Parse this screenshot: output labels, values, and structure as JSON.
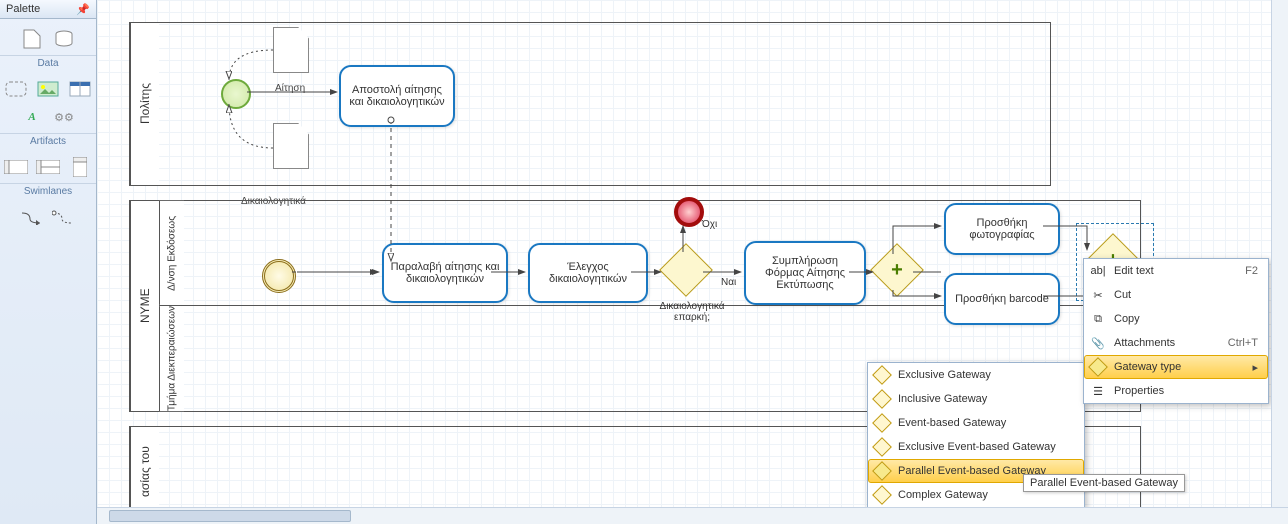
{
  "palette": {
    "title": "Palette",
    "sections": {
      "data": "Data",
      "artifacts": "Artifacts",
      "swimlanes": "Swimlanes"
    }
  },
  "pools": {
    "p1": {
      "title": "Πολίτης"
    },
    "p2": {
      "title": "NYME",
      "lanes": {
        "l1": "Δ/νση Εκδόσεως",
        "l2": "Τμήμα Διεκπεραιώσεων"
      }
    },
    "p3": {
      "title": "ασίας του"
    }
  },
  "data_objects": {
    "d1": "Αίτηση",
    "d2": "Δικαιολογητικά"
  },
  "tasks": {
    "t1": "Αποστολή αίτησης και δικαιολογητικών",
    "t2": "Παραλαβή αίτησης και δικαιολογητικών",
    "t3": "Έλεγχος δικαιολογητικών",
    "t4": "Συμπλήρωση Φόρμας Αίτησης Εκτύπωσης",
    "t5": "Προσθήκη φωτογραφίας",
    "t6": "Προσθήκη barcode"
  },
  "gateways": {
    "g1_label": "Δικαιολογητικά επαρκή;"
  },
  "branches": {
    "no": "Όχι",
    "yes": "Ναι"
  },
  "context_menu": {
    "edit_text": {
      "label": "Edit text",
      "shortcut": "F2"
    },
    "cut": "Cut",
    "copy": "Copy",
    "attachments": {
      "label": "Attachments",
      "shortcut": "Ctrl+T"
    },
    "gateway_type": "Gateway type",
    "properties": "Properties"
  },
  "gateway_submenu": {
    "exclusive": "Exclusive Gateway",
    "inclusive": "Inclusive Gateway",
    "event": "Event-based Gateway",
    "excl_event": "Exclusive Event-based Gateway",
    "par_event": "Parallel Event-based Gateway",
    "complex": "Complex Gateway"
  },
  "tooltip": "Parallel Event-based Gateway",
  "chart_data": {
    "type": "table",
    "description": "BPMN process model with pools/lanes, tasks, gateways and flows",
    "pools": [
      {
        "id": "p1",
        "name": "Πολίτης",
        "lanes": [
          {
            "id": "p1l1",
            "name": ""
          }
        ]
      },
      {
        "id": "p2",
        "name": "NYME",
        "lanes": [
          {
            "id": "p2l1",
            "name": "Δ/νση Εκδόσεως"
          },
          {
            "id": "p2l2",
            "name": "Τμήμα Διεκπεραιώσεων"
          }
        ]
      },
      {
        "id": "p3",
        "name": "ασίας του",
        "lanes": [
          {
            "id": "p3l1",
            "name": ""
          }
        ]
      }
    ],
    "elements": [
      {
        "id": "se1",
        "type": "startEvent",
        "pool": "p1",
        "lane": "p1l1"
      },
      {
        "id": "d1",
        "type": "dataObject",
        "name": "Αίτηση",
        "pool": "p1"
      },
      {
        "id": "d2",
        "type": "dataObject",
        "name": "Δικαιολογητικά",
        "pool": "p1"
      },
      {
        "id": "t1",
        "type": "task",
        "name": "Αποστολή αίτησης και δικαιολογητικών",
        "pool": "p1"
      },
      {
        "id": "se2",
        "type": "startEvent",
        "subtype": "non-interrupting-message",
        "pool": "p2",
        "lane": "p2l1"
      },
      {
        "id": "t2",
        "type": "task",
        "name": "Παραλαβή αίτησης και δικαιολογητικών",
        "pool": "p2",
        "lane": "p2l1"
      },
      {
        "id": "t3",
        "type": "task",
        "name": "Έλεγχος δικαιολογητικών",
        "pool": "p2",
        "lane": "p2l1"
      },
      {
        "id": "g1",
        "type": "exclusiveGateway",
        "name": "Δικαιολογητικά επαρκή;",
        "pool": "p2",
        "lane": "p2l1"
      },
      {
        "id": "ee1",
        "type": "endEvent",
        "pool": "p2",
        "lane": "p2l1"
      },
      {
        "id": "t4",
        "type": "task",
        "name": "Συμπλήρωση Φόρμας Αίτησης Εκτύπωσης",
        "pool": "p2",
        "lane": "p2l1"
      },
      {
        "id": "g2",
        "type": "parallelGateway",
        "pool": "p2",
        "lane": "p2l1"
      },
      {
        "id": "t5",
        "type": "task",
        "name": "Προσθήκη φωτογραφίας",
        "pool": "p2",
        "lane": "p2l1"
      },
      {
        "id": "t6",
        "type": "task",
        "name": "Προσθήκη barcode",
        "pool": "p2",
        "lane": "p2l1"
      },
      {
        "id": "g3",
        "type": "parallelGateway",
        "pool": "p2",
        "lane": "p2l1",
        "selected": true
      },
      {
        "id": "ie1",
        "type": "intermediateEvent",
        "pool": "p2",
        "lane": "p2l1"
      }
    ],
    "sequence_flows": [
      {
        "from": "se1",
        "to": "t1"
      },
      {
        "from": "se2",
        "to": "t2"
      },
      {
        "from": "t2",
        "to": "t3"
      },
      {
        "from": "t3",
        "to": "g1"
      },
      {
        "from": "g1",
        "to": "ee1",
        "condition": "Όχι"
      },
      {
        "from": "g1",
        "to": "t4",
        "condition": "Ναι"
      },
      {
        "from": "t4",
        "to": "g2"
      },
      {
        "from": "g2",
        "to": "t5"
      },
      {
        "from": "g2",
        "to": "t6"
      },
      {
        "from": "t5",
        "to": "g3"
      },
      {
        "from": "t6",
        "to": "g3"
      },
      {
        "from": "g3",
        "to": "ie1"
      }
    ],
    "message_flows": [
      {
        "from": "t1",
        "to": "t2"
      }
    ],
    "data_associations": [
      {
        "from": "d1",
        "to": "se1"
      },
      {
        "from": "d2",
        "to": "se1"
      }
    ]
  }
}
